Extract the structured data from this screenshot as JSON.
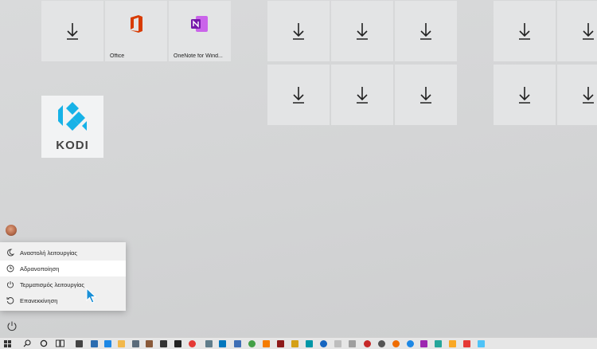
{
  "tiles": {
    "office_label": "Office",
    "onenote_label": "OneNote for Wind..."
  },
  "kodi": {
    "label": "KODI"
  },
  "power_menu": {
    "items": [
      {
        "label": "Αναστολή λειτουργίας",
        "icon": "moon-icon"
      },
      {
        "label": "Αδρανοποίηση",
        "icon": "clock-icon"
      },
      {
        "label": "Τερματισμός λειτουργίας",
        "icon": "power-icon"
      },
      {
        "label": "Επανεκκίνηση",
        "icon": "restart-icon"
      }
    ]
  },
  "colors": {
    "office": "#d83b01",
    "onenote": "#7719aa",
    "kodi": "#17b2e7",
    "cursor": "#1a8fd6"
  }
}
